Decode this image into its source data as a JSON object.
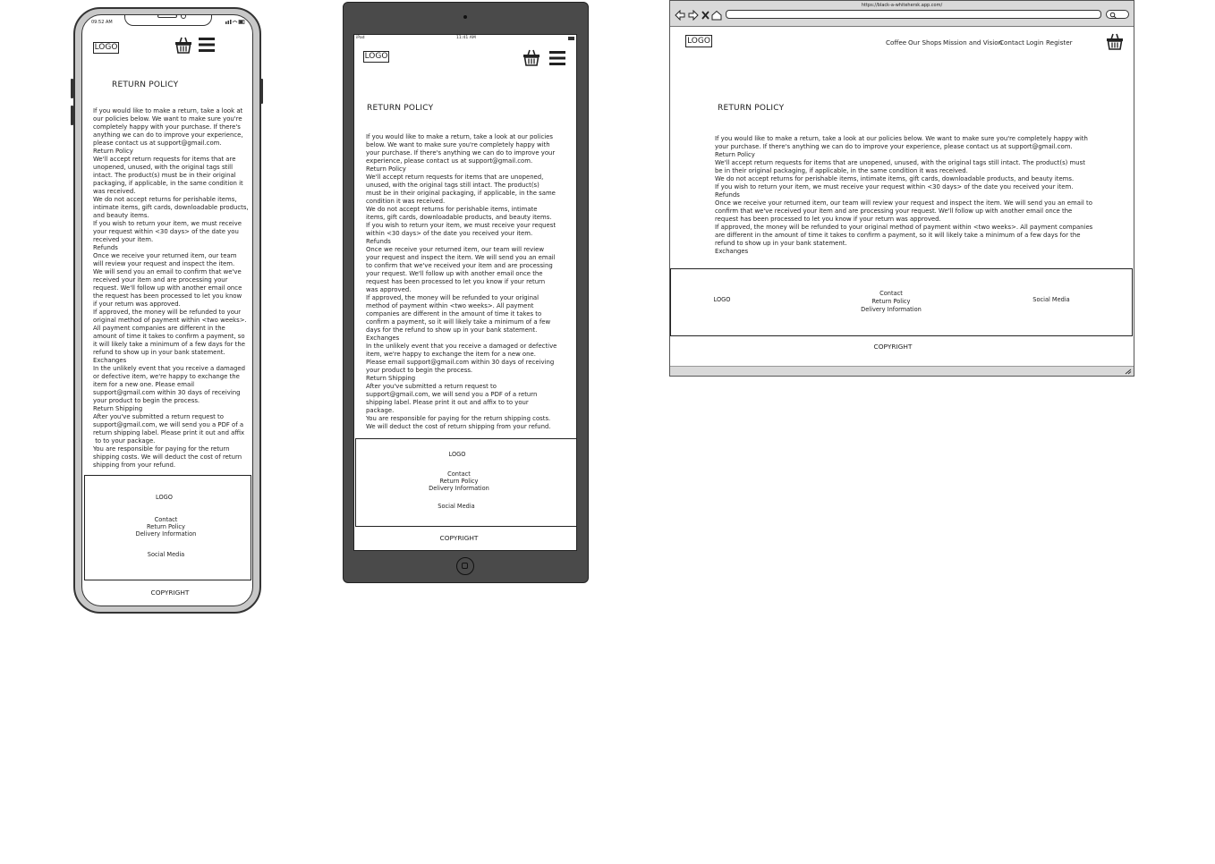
{
  "common": {
    "logo": "LOGO",
    "page_title": "RETURN POLICY",
    "footer_logo": "LOGO",
    "footer_contact": "Contact",
    "footer_return_policy": "Return Policy",
    "footer_delivery": "Delivery Information",
    "footer_social": "Social Media",
    "copyright": "COPYRIGHT"
  },
  "phone": {
    "status_time": "09:52 AM",
    "lines": [
      "If you would like to make a return, take a look at",
      "our policies below. We want to make sure you're",
      "completely happy with your purchase. If there's",
      "anything we can do to improve your experience,",
      "please contact us at support@gmail.com.",
      "Return Policy",
      "We'll accept return requests for items that are",
      "unopened, unused, with the original tags still",
      "intact. The product(s) must be in their original",
      "packaging, if applicable, in the same condition it",
      "was received.",
      "We do not accept returns for perishable items,",
      "intimate items, gift cards, downloadable products,",
      "and beauty items.",
      "If you wish to return your item, we must receive",
      "your request within <30 days> of the date you",
      "received your item.",
      "Refunds",
      "Once we receive your returned item, our team",
      "will review your request and inspect the item.",
      "We will send you an email to confirm that we've",
      "received your item and are processing your",
      "request. We'll follow up with another email once",
      "the request has been processed to let you know",
      "if your return was approved.",
      "If approved, the money will be refunded to your",
      "original method of payment within <two weeks>.",
      "All payment companies are different in the",
      "amount of time it takes to confirm a payment, so",
      "it will likely take a minimum of a few days for the",
      "refund to show up in your bank statement.",
      "Exchanges",
      "In the unlikely event that you receive a damaged",
      "or defective item, we're happy to exchange the",
      "item for a new one. Please email",
      "support@gmail.com within 30 days of receiving",
      "your product to begin the process.",
      "Return Shipping",
      "After you've submitted a return request to",
      "support@gmail.com, we will send you a PDF of a",
      "return shipping label. Please print it out and affix",
      " to to your package.",
      "You are responsible for paying for the return",
      "shipping costs. We will deduct the cost of return",
      "shipping from your refund."
    ]
  },
  "tablet": {
    "status_left": "iPad",
    "status_time": "11:41 AM",
    "lines": [
      "If you would like to make a return, take a look at our policies",
      "below. We want to make sure you're completely happy with",
      "your purchase. If there's anything we can do to improve your",
      "experience, please contact us at support@gmail.com.",
      "Return Policy",
      "We'll accept return requests for items that are unopened,",
      "unused, with the original tags still intact. The product(s)",
      "must be in their original packaging, if applicable, in the same",
      "condition it was received.",
      "We do not accept returns for perishable items, intimate",
      "items, gift cards, downloadable products, and beauty items.",
      "If you wish to return your item, we must receive your request",
      "within <30 days> of the date you received your item.",
      "Refunds",
      "Once we receive your returned item, our team will review",
      "your request and inspect the item. We will send you an email",
      "to confirm that we've received your item and are processing",
      "your request. We'll follow up with another email once the",
      "request has been processed to let you know if your return",
      "was approved.",
      "If approved, the money will be refunded to your original",
      "method of payment within <two weeks>. All payment",
      "companies are different in the amount of time it takes to",
      "confirm a payment, so it will likely take a minimum of a few",
      "days for the refund to show up in your bank statement.",
      "Exchanges",
      "In the unlikely event that you receive a damaged or defective",
      "item, we're happy to exchange the item for a new one.",
      "Please email support@gmail.com within 30 days of receiving",
      "your product to begin the process.",
      "Return Shipping",
      "After you've submitted a return request to",
      "support@gmail.com, we will send you a PDF of a return",
      "shipping label. Please print it out and affix to to your",
      "package.",
      "You are responsible for paying for the return shipping costs.",
      "We will deduct the cost of return shipping from your refund."
    ]
  },
  "browser": {
    "url": "https://black-a-whitehersk.app.com/",
    "nav": {
      "coffee": "Coffee",
      "shops": "Our Shops",
      "mission": "Mission and Vision",
      "contact": "Contact",
      "login": "Login",
      "register": "Register"
    },
    "lines": [
      "If you would like to make a return, take a look at our policies below. We want to make sure you're completely happy with",
      "your purchase. If there's anything we can do to improve your experience, please contact us at support@gmail.com.",
      "Return Policy",
      "We'll accept return requests for items that are unopened, unused, with the original tags still intact. The product(s) must",
      "be in their original packaging, if applicable, in the same condition it was received.",
      "We do not accept returns for perishable items, intimate items, gift cards, downloadable products, and beauty items.",
      "If you wish to return your item, we must receive your request within <30 days> of the date you received your item.",
      "Refunds",
      "Once we receive your returned item, our team will review your request and inspect the item. We will send you an email to",
      "confirm that we've received your item and are processing your request. We'll follow up with another email once the",
      "request has been processed to let you know if your return was approved.",
      "If approved, the money will be refunded to your original method of payment within <two weeks>. All payment companies",
      "are different in the amount of time it takes to confirm a payment, so it will likely take a minimum of a few days for the",
      "refund to show up in your bank statement.",
      "Exchanges"
    ]
  },
  "icons": {
    "cart": "basket-icon",
    "menu": "hamburger-icon"
  }
}
